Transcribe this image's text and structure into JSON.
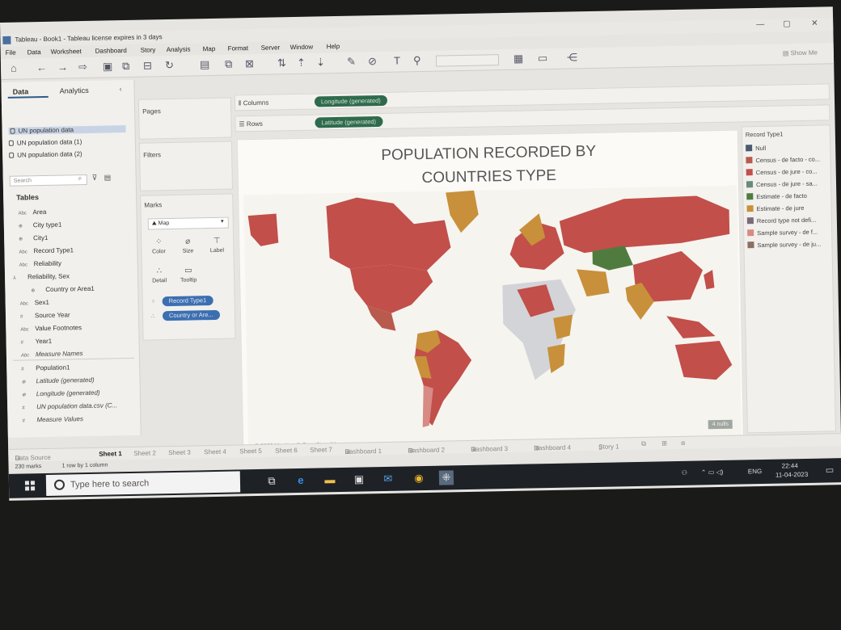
{
  "window": {
    "title": "Tableau - Book1 - Tableau license expires in 3 days"
  },
  "menu": [
    "File",
    "Data",
    "Worksheet",
    "Dashboard",
    "Story",
    "Analysis",
    "Map",
    "Format",
    "Server",
    "Window",
    "Help"
  ],
  "toolbar": {
    "show_me_label": "Show Me"
  },
  "data_pane": {
    "tab_data": "Data",
    "tab_analytics": "Analytics",
    "data_sources": [
      "UN population data",
      "UN population data (1)",
      "UN population data (2)"
    ],
    "search_placeholder": "Search",
    "tables_heading": "Tables",
    "fields": [
      {
        "type": "Abc",
        "name": "Area"
      },
      {
        "type": "⊕",
        "name": "City type1"
      },
      {
        "type": "⊕",
        "name": "City1"
      },
      {
        "type": "Abc",
        "name": "Record Type1"
      },
      {
        "type": "Abc",
        "name": "Reliability"
      },
      {
        "type": "⅄",
        "name": "Reliability, Sex"
      },
      {
        "type": "⊕",
        "name": "Country or Area1"
      },
      {
        "type": "Abc",
        "name": "Sex1"
      },
      {
        "type": "#",
        "name": "Source Year"
      },
      {
        "type": "Abc",
        "name": "Value Footnotes"
      },
      {
        "type": "#",
        "name": "Year1"
      },
      {
        "type": "Abc",
        "name": "Measure Names"
      }
    ],
    "measures": [
      {
        "type": "#",
        "name": "Population1"
      },
      {
        "type": "⊕",
        "name": "Latitude (generated)"
      },
      {
        "type": "⊕",
        "name": "Longitude (generated)"
      },
      {
        "type": "#",
        "name": "UN population data.csv (C..."
      },
      {
        "type": "#",
        "name": "Measure Values"
      }
    ]
  },
  "shelves": {
    "pages": "Pages",
    "filters": "Filters",
    "marks": "Marks",
    "mark_type": "Map",
    "mark_cards": [
      "Color",
      "Size",
      "Label",
      "Detail",
      "Tooltip"
    ],
    "mark_pills": [
      "Record Type1",
      "Country or Are..."
    ],
    "columns_label": "Columns",
    "rows_label": "Rows",
    "columns_pill": "Longitude (generated)",
    "rows_pill": "Latitude (generated)"
  },
  "viz": {
    "title_line1": "POPULATION RECORDED BY",
    "title_line2": "COUNTRIES TYPE",
    "attribution": "© 2023 Mapbox © OpenStreetMap",
    "nulls_badge": "4 nulls"
  },
  "legend": {
    "title": "Record Type1",
    "items": [
      {
        "label": "Null",
        "color": "#4b5a6e"
      },
      {
        "label": "Census - de facto - co...",
        "color": "#b85a4e"
      },
      {
        "label": "Census - de jure - co...",
        "color": "#c24f4a"
      },
      {
        "label": "Census - de jure - sa...",
        "color": "#6a8a78"
      },
      {
        "label": "Estimate - de facto",
        "color": "#4f7c3e"
      },
      {
        "label": "Estimate - de jure",
        "color": "#c8903a"
      },
      {
        "label": "Record type not defi...",
        "color": "#7a6a78"
      },
      {
        "label": "Sample survey - de f...",
        "color": "#d88a84"
      },
      {
        "label": "Sample survey - de ju...",
        "color": "#8a7060"
      }
    ]
  },
  "sheet_tabs": {
    "data_source": "Data Source",
    "tabs": [
      "Sheet 1",
      "Sheet 2",
      "Sheet 3",
      "Sheet 4",
      "Sheet 5",
      "Sheet 6",
      "Sheet 7",
      "Dashboard 1",
      "Dashboard 2",
      "Dashboard 3",
      "Dashboard 4",
      "Story 1"
    ]
  },
  "status": {
    "marks": "230 marks",
    "rows_cols": "1 row by 1 column"
  },
  "taskbar": {
    "search_placeholder": "Type here to search",
    "language": "ENG",
    "time": "22:44",
    "date": "11-04-2023"
  }
}
